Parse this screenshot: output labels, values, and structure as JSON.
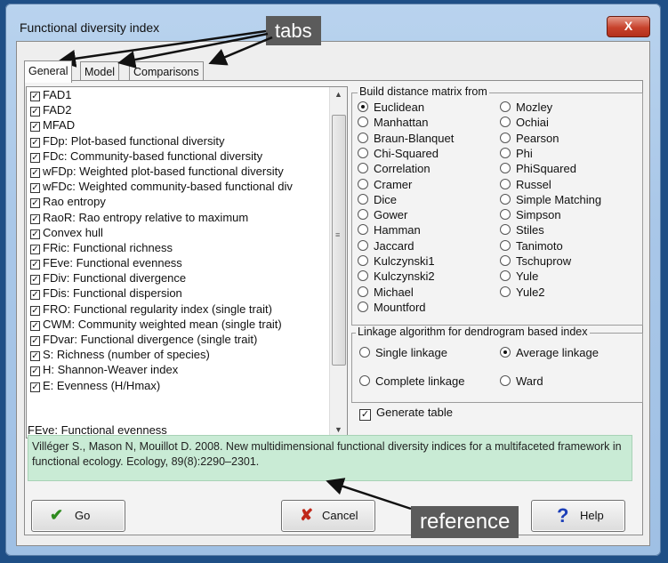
{
  "window": {
    "title": "Functional diversity index",
    "close_label": "X"
  },
  "annotations": {
    "tabs": "tabs",
    "reference": "reference"
  },
  "tabs": [
    {
      "label": "General"
    },
    {
      "label": "Model"
    },
    {
      "label": "Comparisons"
    }
  ],
  "indices": [
    {
      "label": "FAD1",
      "checked": true
    },
    {
      "label": "FAD2",
      "checked": true
    },
    {
      "label": "MFAD",
      "checked": true
    },
    {
      "label": "FDp: Plot-based functional diversity",
      "checked": true
    },
    {
      "label": "FDc: Community-based functional diversity",
      "checked": true
    },
    {
      "label": "wFDp: Weighted plot-based functional diversity",
      "checked": true
    },
    {
      "label": "wFDc: Weighted community-based functional div",
      "checked": true
    },
    {
      "label": "Rao entropy",
      "checked": true
    },
    {
      "label": "RaoR: Rao entropy relative to maximum",
      "checked": true
    },
    {
      "label": "Convex hull",
      "checked": true
    },
    {
      "label": "FRic: Functional richness",
      "checked": true
    },
    {
      "label": "FEve: Functional evenness",
      "checked": true
    },
    {
      "label": "FDiv: Functional divergence",
      "checked": true
    },
    {
      "label": "FDis: Functional dispersion",
      "checked": true
    },
    {
      "label": "FRO: Functional regularity index (single trait)",
      "checked": true
    },
    {
      "label": "CWM: Community weighted mean (single trait)",
      "checked": true
    },
    {
      "label": "FDvar: Functional divergence (single trait)",
      "checked": true
    },
    {
      "label": "S: Richness (number of species)",
      "checked": true
    },
    {
      "label": "H: Shannon-Weaver index",
      "checked": true
    },
    {
      "label": "E: Evenness (H/Hmax)",
      "checked": true
    }
  ],
  "distance": {
    "label": "Build distance matrix from",
    "selected": "Euclidean",
    "left": [
      "Euclidean",
      "Manhattan",
      "Braun-Blanquet",
      "Chi-Squared",
      "Correlation",
      "Cramer",
      "Dice",
      "Gower",
      "Hamman",
      "Jaccard",
      "Kulczynski1",
      "Kulczynski2",
      "Michael",
      "Mountford"
    ],
    "right": [
      "Mozley",
      "Ochiai",
      "Pearson",
      "Phi",
      "PhiSquared",
      "Russel",
      "Simple Matching",
      "Simpson",
      "Stiles",
      "Tanimoto",
      "Tschuprow",
      "Yule",
      "Yule2"
    ]
  },
  "linkage": {
    "label": "Linkage algorithm for dendrogram based index",
    "selected": "Average linkage",
    "options": [
      "Single linkage",
      "Average linkage",
      "Complete linkage",
      "Ward"
    ]
  },
  "generate_table": {
    "label": "Generate table",
    "checked": true
  },
  "reference": {
    "name": "FEve: Functional evenness",
    "text": "Villéger S., Mason N, Mouillot D. 2008. New multidimensional functional diversity indices for a multifaceted framework in functional ecology. Ecology, 89(8):2290–2301."
  },
  "buttons": {
    "go": "Go",
    "cancel": "Cancel",
    "help": "Help"
  },
  "icons": {
    "close": "close-icon",
    "go": "checkmark-icon",
    "cancel": "x-icon",
    "help": "question-icon"
  },
  "colors": {
    "reference_bg": "#c9ebd5",
    "close": "#c7422c",
    "go_icon": "#2e8b1e",
    "cancel_icon": "#c0281a",
    "help_icon": "#1c3fb8"
  }
}
